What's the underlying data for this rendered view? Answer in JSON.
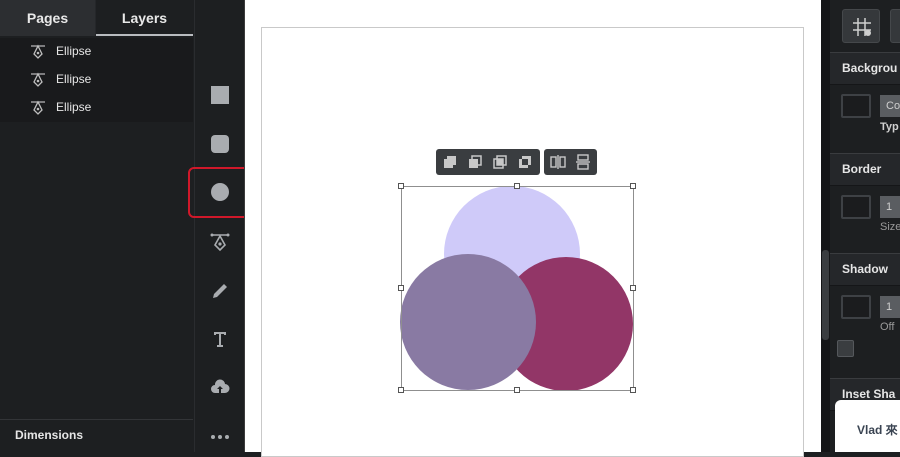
{
  "left_panel": {
    "tabs": [
      "Pages",
      "Layers"
    ],
    "active_tab": "Layers",
    "layers": [
      {
        "label": "Ellipse",
        "icon": "pen-tool-icon"
      },
      {
        "label": "Ellipse",
        "icon": "pen-tool-icon"
      },
      {
        "label": "Ellipse",
        "icon": "pen-tool-icon"
      }
    ],
    "dimensions_label": "Dimensions"
  },
  "toolbar": {
    "tools": [
      "rectangle-tool",
      "rounded-rectangle-tool",
      "ellipse-tool",
      "pen-tool",
      "pencil-tool",
      "text-tool",
      "upload-tool",
      "more-tool"
    ],
    "selected_tool": "ellipse-tool",
    "highlight_color": "#d0182a"
  },
  "canvas": {
    "shapes": [
      {
        "type": "ellipse",
        "color": "#cfcaf9"
      },
      {
        "type": "ellipse",
        "color": "#923667"
      },
      {
        "type": "ellipse",
        "color": "#897aa3"
      }
    ],
    "context_toolbar": [
      "union-icon",
      "subtract-icon",
      "intersect-icon",
      "exclude-icon",
      "flip-horizontal-icon",
      "flip-vertical-icon"
    ]
  },
  "right_panel": {
    "sections": {
      "background": "Backgrou",
      "border": "Border",
      "shadow": "Shadow",
      "inset_shadow": "Inset Sha"
    },
    "background_type_button": "Co",
    "background_type_label": "Typ",
    "border_size_value": "1",
    "border_size_label": "Size",
    "shadow_offset_value": "1",
    "shadow_offset_label": "Off",
    "toast_text": "Vlad 來"
  }
}
